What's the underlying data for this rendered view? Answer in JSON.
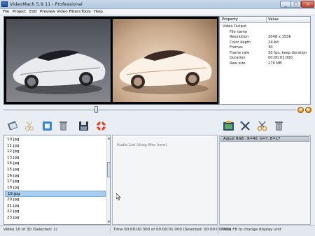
{
  "window": {
    "title": "VideoMach 5.9.11 - Professional"
  },
  "menu": [
    "File",
    "Project",
    "Edit",
    "Preview",
    "Video Filters",
    "Tools",
    "Help"
  ],
  "properties": {
    "header": {
      "property": "Property",
      "value": "Value"
    },
    "group": "Video Output",
    "rows": [
      {
        "key": "File name",
        "value": ""
      },
      {
        "key": "Resolution",
        "value": "2048 x 1536"
      },
      {
        "key": "Color depth",
        "value": "24-bit"
      },
      {
        "key": "Frames",
        "value": "30"
      },
      {
        "key": "Frame rate",
        "value": "30 fps, keep duration"
      },
      {
        "key": "Duration",
        "value": "00:00:01.000"
      },
      {
        "key": "Raw size",
        "value": "270 MB"
      }
    ]
  },
  "seek": {
    "position_fraction": 0.31
  },
  "toolbar": {
    "left": [
      "open-file-icon",
      "cut-disabled-icon",
      "frame-icon",
      "delete-icon",
      "save-icon",
      "help-lifebuoy-icon"
    ],
    "right": [
      "add-filter-icon",
      "filter-tools-icon",
      "scissors-icon",
      "filter-delete-icon"
    ]
  },
  "files": [
    "10.jpg",
    "11.jpg",
    "12.jpg",
    "13.jpg",
    "14.jpg",
    "15.jpg",
    "16.jpg",
    "17.jpg",
    "18.jpg",
    "19.jpg",
    "20.jpg",
    "21.jpg",
    "22.jpg",
    "23.jpg"
  ],
  "selected_file_index": 9,
  "audio": {
    "hint": "Audio List (drag files here)"
  },
  "filters": [
    "Adjust RGB : R=40, G=7, B=17"
  ],
  "status": {
    "video": "Video 10 of 30  (Selected: 1)",
    "time": "Time 00:00:00.300 of 00:00:01.000  (Selected: 00:00:00.000)",
    "hint": "Press F8 to change display unit"
  }
}
